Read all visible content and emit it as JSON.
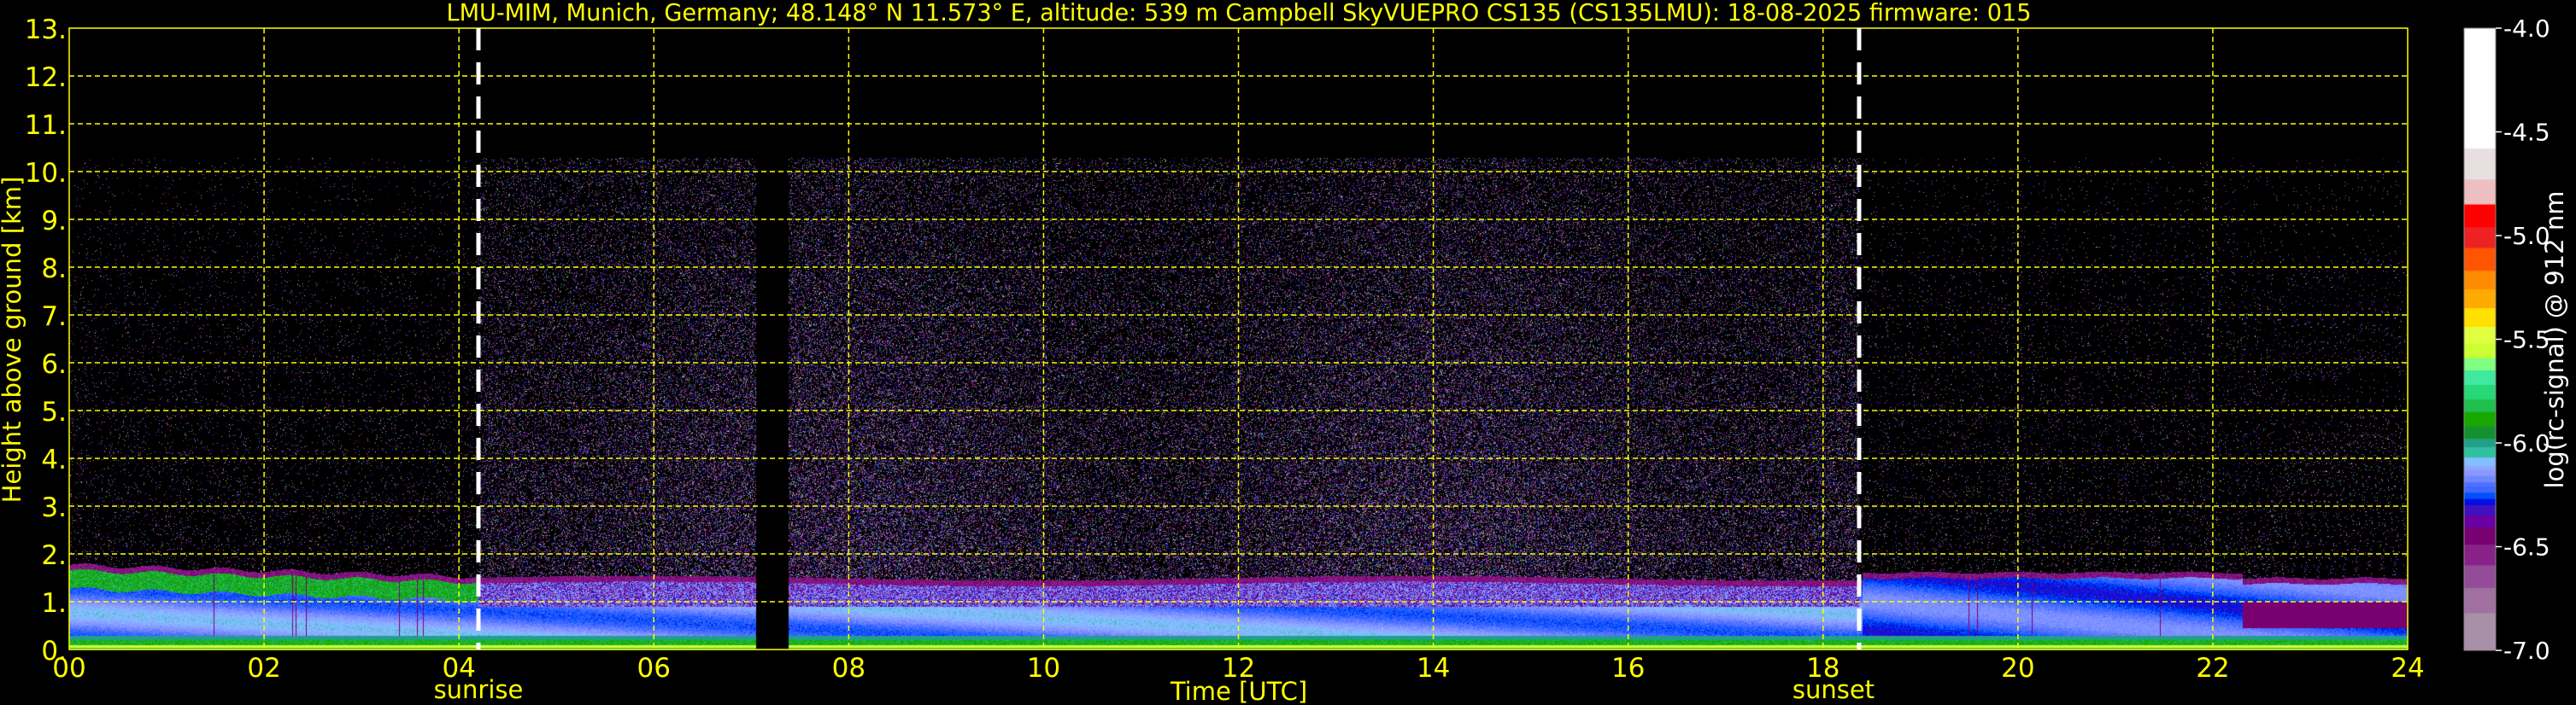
{
  "chart_data": {
    "type": "heatmap",
    "title": "LMU-MIM, Munich, Germany; 48.148° N 11.573° E, altitude: 539 m    Campbell SkyVUEPRO CS135 (CS135LMU): 18-08-2025    firmware: 015",
    "xlabel": "Time [UTC]",
    "ylabel": "Height above ground [km]",
    "xlim": [
      0,
      24
    ],
    "ylim": [
      0,
      13
    ],
    "x_ticks": [
      0,
      2,
      4,
      6,
      8,
      10,
      12,
      14,
      16,
      18,
      20,
      22,
      24
    ],
    "x_tick_labels": [
      "00",
      "02",
      "04",
      "06",
      "08",
      "10",
      "12",
      "14",
      "16",
      "18",
      "20",
      "22",
      "24"
    ],
    "y_ticks": [
      0,
      1,
      2,
      3,
      4,
      5,
      6,
      7,
      8,
      9,
      10,
      11,
      12,
      13
    ],
    "y_tick_labels": [
      "0.",
      "1.",
      "2.",
      "3.",
      "4.",
      "5.",
      "6.",
      "7.",
      "8.",
      "9.",
      "10.",
      "11.",
      "12.",
      "13."
    ],
    "grid": true,
    "grid_color": "#ffff00",
    "text_color": "#ffff00",
    "sunrise": {
      "time": 4.2,
      "label": "sunrise"
    },
    "sunset": {
      "time": 18.37,
      "label": "sunset"
    },
    "data_gap": [
      7.05,
      7.38
    ],
    "max_range_km": 10.3,
    "colorbar": {
      "label": "log(rc-signal) @ 912 nm",
      "range": [
        -7.0,
        -4.0
      ],
      "ticks": [
        -4.0,
        -4.5,
        -5.0,
        -5.5,
        -6.0,
        -6.5,
        -7.0
      ],
      "tick_labels": [
        "-4.0",
        "-4.5",
        "-5.0",
        "-5.5",
        "-6.0",
        "-6.5",
        "-7.0"
      ],
      "segments": [
        {
          "from": -4.0,
          "to": -4.58,
          "color": "#ffffff"
        },
        {
          "from": -4.58,
          "to": -4.73,
          "color": "#e8e0e0"
        },
        {
          "from": -4.73,
          "to": -4.85,
          "color": "#ecc0c0"
        },
        {
          "from": -4.85,
          "to": -4.96,
          "color": "#ff0000"
        },
        {
          "from": -4.96,
          "to": -5.06,
          "color": "#ee2222"
        },
        {
          "from": -5.06,
          "to": -5.17,
          "color": "#ff5500"
        },
        {
          "from": -5.17,
          "to": -5.26,
          "color": "#ff8c00"
        },
        {
          "from": -5.26,
          "to": -5.35,
          "color": "#ffaa00"
        },
        {
          "from": -5.35,
          "to": -5.44,
          "color": "#ffe000"
        },
        {
          "from": -5.44,
          "to": -5.52,
          "color": "#e0ff40"
        },
        {
          "from": -5.52,
          "to": -5.59,
          "color": "#ccff33"
        },
        {
          "from": -5.59,
          "to": -5.65,
          "color": "#80ff80"
        },
        {
          "from": -5.65,
          "to": -5.72,
          "color": "#40e8a0"
        },
        {
          "from": -5.72,
          "to": -5.79,
          "color": "#28d878"
        },
        {
          "from": -5.79,
          "to": -5.85,
          "color": "#20c050"
        },
        {
          "from": -5.85,
          "to": -5.92,
          "color": "#18a800"
        },
        {
          "from": -5.92,
          "to": -5.98,
          "color": "#149030"
        },
        {
          "from": -5.98,
          "to": -6.02,
          "color": "#20a088"
        },
        {
          "from": -6.02,
          "to": -6.07,
          "color": "#30c0a0"
        },
        {
          "from": -6.07,
          "to": -6.11,
          "color": "#80c0ff"
        },
        {
          "from": -6.11,
          "to": -6.13,
          "color": "#90a8ff"
        },
        {
          "from": -6.13,
          "to": -6.16,
          "color": "#8898ff"
        },
        {
          "from": -6.16,
          "to": -6.19,
          "color": "#7088ff"
        },
        {
          "from": -6.19,
          "to": -6.21,
          "color": "#5070ff"
        },
        {
          "from": -6.21,
          "to": -6.24,
          "color": "#4068ff"
        },
        {
          "from": -6.24,
          "to": -6.27,
          "color": "#0050ff"
        },
        {
          "from": -6.27,
          "to": -6.3,
          "color": "#0010e0"
        },
        {
          "from": -6.3,
          "to": -6.35,
          "color": "#4010c0"
        },
        {
          "from": -6.35,
          "to": -6.41,
          "color": "#6a00a0"
        },
        {
          "from": -6.41,
          "to": -6.49,
          "color": "#780070"
        },
        {
          "from": -6.49,
          "to": -6.59,
          "color": "#882288"
        },
        {
          "from": -6.59,
          "to": -6.7,
          "color": "#944c98"
        },
        {
          "from": -6.7,
          "to": -6.82,
          "color": "#a070a0"
        },
        {
          "from": -6.82,
          "to": -7.0,
          "color": "#a890a8"
        }
      ]
    }
  }
}
